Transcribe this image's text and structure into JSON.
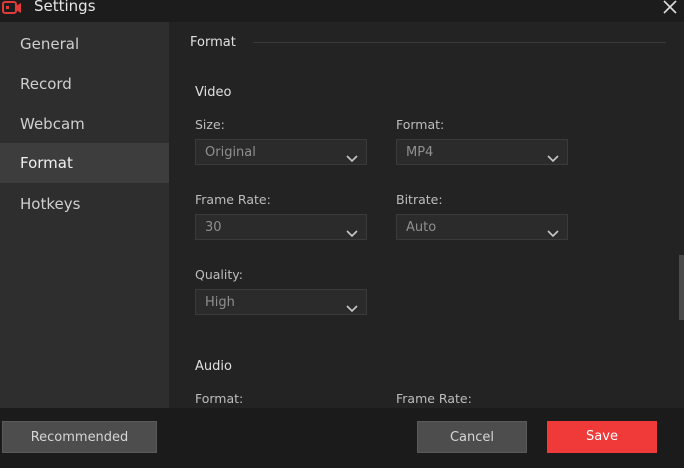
{
  "window": {
    "title": "Settings",
    "app_icon": "video-camera-icon",
    "close_icon": "close-icon"
  },
  "sidebar": {
    "items": [
      {
        "label": "General",
        "active": false
      },
      {
        "label": "Record",
        "active": false
      },
      {
        "label": "Webcam",
        "active": false
      },
      {
        "label": "Format",
        "active": true
      },
      {
        "label": "Hotkeys",
        "active": false
      }
    ]
  },
  "main": {
    "section_title": "Format",
    "video": {
      "title": "Video",
      "size": {
        "label": "Size:",
        "value": "Original"
      },
      "format": {
        "label": "Format:",
        "value": "MP4"
      },
      "frame_rate": {
        "label": "Frame Rate:",
        "value": "30"
      },
      "bitrate": {
        "label": "Bitrate:",
        "value": "Auto"
      },
      "quality": {
        "label": "Quality:",
        "value": "High"
      }
    },
    "audio": {
      "title": "Audio",
      "format_label": "Format:",
      "frame_rate_label": "Frame Rate:"
    }
  },
  "footer": {
    "recommended_label": "Recommended",
    "cancel_label": "Cancel",
    "save_label": "Save"
  },
  "colors": {
    "accent": "#f03a3a",
    "sidebar_active": "#3d3d3d"
  }
}
